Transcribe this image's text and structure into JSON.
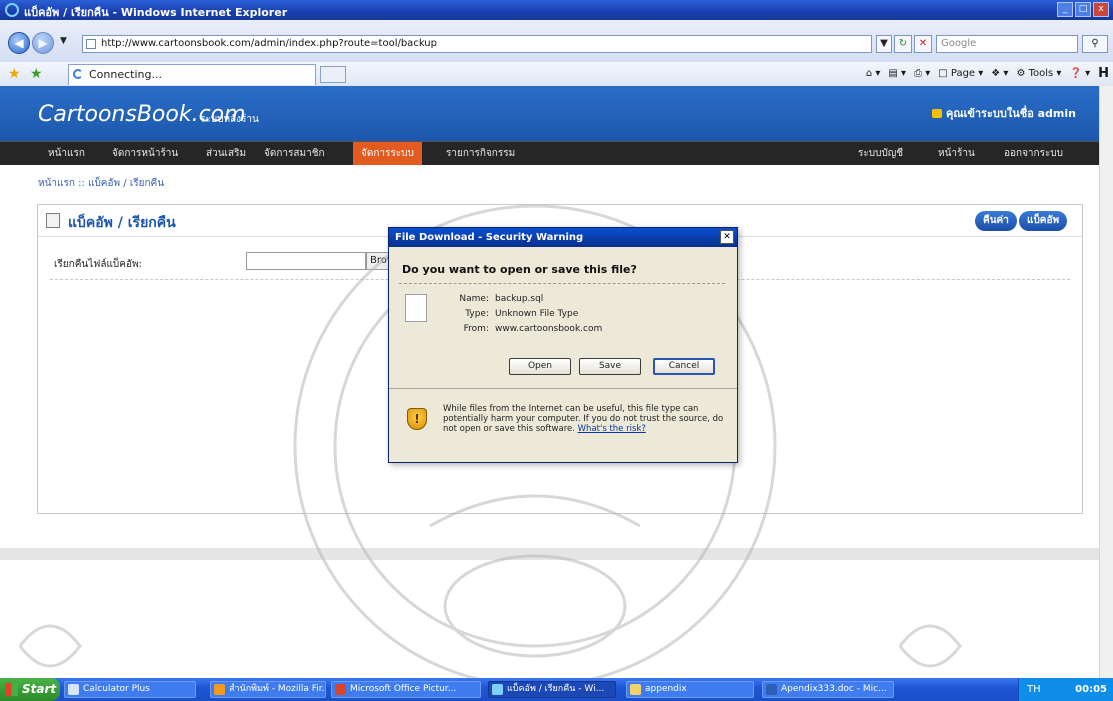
{
  "window": {
    "title": "แบ็คอัพ / เรียกคืน - Windows Internet Explorer",
    "controls": [
      "_",
      "□",
      "x"
    ]
  },
  "browser": {
    "address": "http://www.cartoonsbook.com/admin/index.php?route=tool/backup",
    "search_placeholder": "Google",
    "tab_label": "Connecting...",
    "commands": {
      "page": "Page",
      "tools": "Tools"
    }
  },
  "site": {
    "logo": "CartoonsBook.com",
    "subtitle": "ระบบหลังร้าน",
    "login_info": "คุณเข้าระบบในชื่อ admin",
    "menu_left": [
      "หน้าแรก",
      "จัดการหน้าร้าน",
      "ส่วนเสริม",
      "จัดการสมาชิก",
      "จัดการระบบ",
      "รายการกิจกรรม"
    ],
    "menu_active_index": 4,
    "menu_right": [
      "ระบบบัญชี",
      "หน้าร้าน",
      "ออกจากระบบ"
    ],
    "breadcrumb": "หน้าแรก :: แบ็คอัพ / เรียกคืน"
  },
  "panel": {
    "title": "แบ็คอัพ / เรียกคืน",
    "restore_button": "คืนค่า",
    "backup_button": "แบ็คอัพ",
    "restore_label": "เรียกคืนไฟล์แบ็คอัพ:",
    "browse_label": "Browse..."
  },
  "dialog": {
    "title": "File Download - Security Warning",
    "question": "Do you want to open or save this file?",
    "name_label": "Name:",
    "name_value": "backup.sql",
    "type_label": "Type:",
    "type_value": "Unknown File Type",
    "from_label": "From:",
    "from_value": "www.cartoonsbook.com",
    "buttons": {
      "open": "Open",
      "save": "Save",
      "cancel": "Cancel"
    },
    "warning": "While files from the Internet can be useful, this file type can potentially harm your computer. If you do not trust the source, do not open or save this software.",
    "risk_link": "What's the risk?"
  },
  "taskbar": {
    "start": "Start",
    "items": [
      "Calculator Plus",
      "สำนักพิมพ์ - Mozilla Fir...",
      "Microsoft Office Pictur...",
      "แบ็คอัพ / เรียกคืน - Wi...",
      "appendix",
      "Apendix333.doc - Mic..."
    ],
    "active_index": 3,
    "lang": "TH",
    "clock": "00:05"
  },
  "colors": {
    "header_blue": "#1d57ad",
    "menu_bar": "#262626",
    "menu_active": "#e35b20",
    "taskbar_blue": "#1f56d6"
  }
}
